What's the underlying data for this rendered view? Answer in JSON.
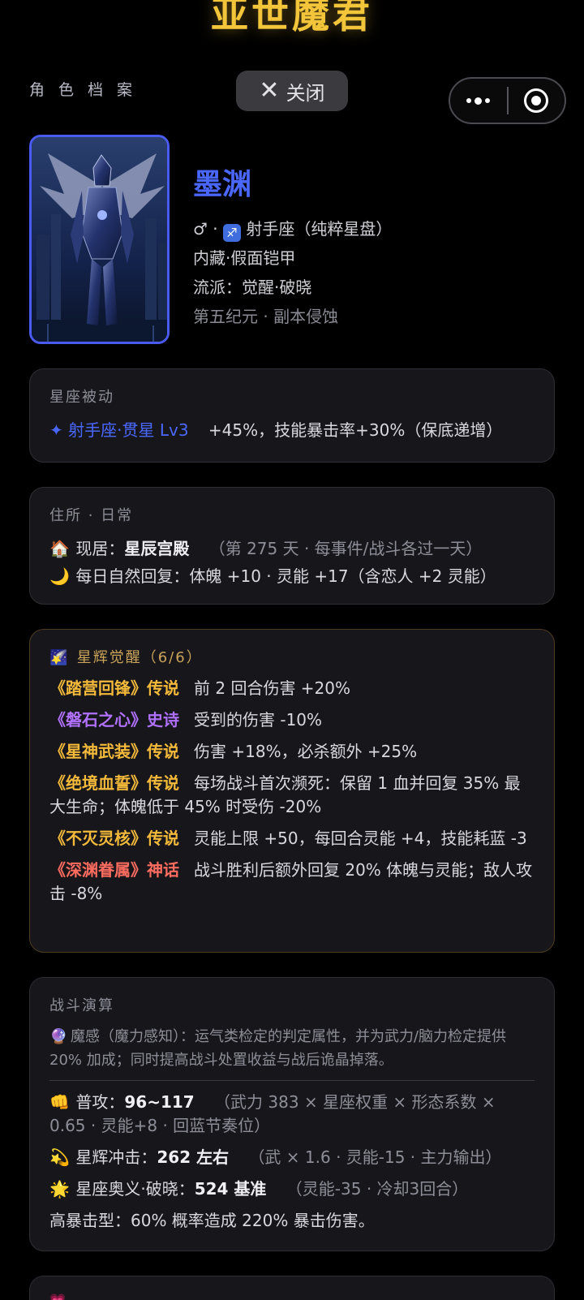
{
  "app": {
    "title": "亚世魔君",
    "profile_label": "角色档案",
    "close_label": "关闭"
  },
  "character": {
    "name": "墨渊",
    "gender_symbol": "♂",
    "zodiac_icon": "♐",
    "zodiac_text": "射手座（纯粹星盘）",
    "line2": "内藏·假面铠甲",
    "line3": "流派：觉醒·破晓",
    "line4": "第五纪元 · 副本侵蚀"
  },
  "passive": {
    "title": "星座被动",
    "icon": "✦",
    "name": "射手座·贯星 Lv3",
    "desc": "+45%，技能暴击率+30%（保底递增）"
  },
  "residence": {
    "title": "住所 · 日常",
    "home_icon": "🏠",
    "home_label": "现居：",
    "home_name": "星辰宫殿",
    "home_note": "（第 275 天 · 每事件/战斗各过一天）",
    "moon_icon": "🌙",
    "daily_text": "每日自然回复：体魄 +10 · 灵能 +17（含恋人 +2 灵能）"
  },
  "awakening": {
    "title_icon": "🌠",
    "title": "星辉觉醒（6/6）",
    "items": [
      {
        "name": "《踏营回锋》传说",
        "desc": "前 2 回合伤害 +20%"
      },
      {
        "name": "《磐石之心》史诗",
        "desc": "受到的伤害 -10%"
      },
      {
        "name": "《星神武装》传说",
        "desc": "伤害 +18%，必杀额外 +25%"
      },
      {
        "name": "《绝境血誓》传说",
        "desc": "每场战斗首次濒死：保留 1 血并回复 35% 最大生命；体魄低于 45% 时受伤 -20%"
      },
      {
        "name": "《不灭灵核》传说",
        "desc": "灵能上限 +50，每回合灵能 +4，技能耗蓝 -3"
      },
      {
        "name": "《深渊眷属》神话",
        "desc": "战斗胜利后额外回复 20% 体魄与灵能；敌人攻击 -8%"
      }
    ]
  },
  "combat": {
    "title": "战斗演算",
    "sense_icon": "🔮",
    "sense_text": "魔感（魔力感知）：运气类检定的判定属性，并为武力/脑力检定提供 20% 加成；同时提高战斗处置收益与战后诡晶掉落。",
    "attack_icon": "👊",
    "attack_label": "普攻：",
    "attack_value": "96~117",
    "attack_note": "（武力 383 × 星座权重 × 形态系数 × 0.65 · 灵能+8 · 回蓝节奏位）",
    "impact_icon": "💫",
    "impact_label": "星辉冲击：",
    "impact_value": "262 左右",
    "impact_note": "（武 × 1.6 · 灵能-15 · 主力输出）",
    "ult_icon": "🌟",
    "ult_label": "星座奥义·破晓：",
    "ult_value": "524 基准",
    "ult_note": "（灵能-35 · 冷却3回合）",
    "crit_text": "高暴击型：60% 概率造成 220% 暴击伤害。"
  },
  "next_card": {
    "icon": "💗"
  }
}
